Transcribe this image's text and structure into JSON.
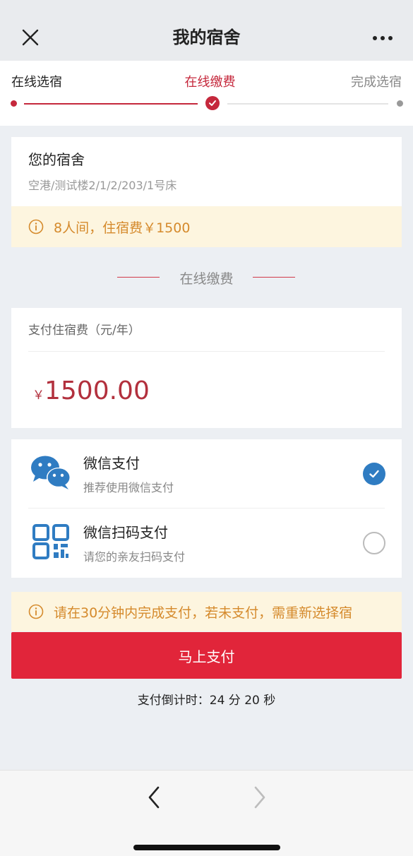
{
  "navbar": {
    "title": "我的宿舍",
    "close_icon": "close-icon",
    "more_icon": "more-dots-icon"
  },
  "steps": [
    {
      "label": "在线选宿",
      "state": "done"
    },
    {
      "label": "在线缴费",
      "state": "current"
    },
    {
      "label": "完成选宿",
      "state": "pending"
    }
  ],
  "dorm": {
    "title": "您的宿舍",
    "address": "空港/测试楼2/1/2/203/1号床",
    "notice": "8人间，住宿费￥1500"
  },
  "section_title": "在线缴费",
  "fee": {
    "label": "支付住宿费（元/年）",
    "currency_symbol": "￥",
    "amount": "1500.00"
  },
  "payment_methods": [
    {
      "title": "微信支付",
      "subtitle": "推荐使用微信支付",
      "icon": "wechat-icon",
      "selected": true
    },
    {
      "title": "微信扫码支付",
      "subtitle": "请您的亲友扫码支付",
      "icon": "qr-code-icon",
      "selected": false
    }
  ],
  "payment_notice": "请在30分钟内完成支付，若未支付，需重新选择宿",
  "pay_button_label": "马上支付",
  "countdown": "支付倒计时：24 分 20 秒",
  "toolbar": {
    "back_icon": "chevron-left-icon",
    "forward_icon": "chevron-right-icon"
  },
  "colors": {
    "accent": "#c5283c",
    "button": "#e1253a",
    "notice_text": "#d58a2c",
    "notice_bg": "#fdf5df",
    "radio_selected": "#2f7cc2"
  }
}
